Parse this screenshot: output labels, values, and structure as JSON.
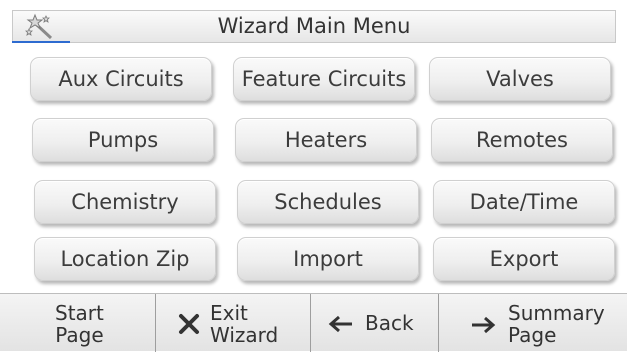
{
  "header": {
    "title": "Wizard Main Menu",
    "icon": "magic-wand-icon"
  },
  "menu": {
    "buttons": [
      {
        "label": "Aux Circuits"
      },
      {
        "label": "Feature Circuits"
      },
      {
        "label": "Valves"
      },
      {
        "label": "Pumps"
      },
      {
        "label": "Heaters"
      },
      {
        "label": "Remotes"
      },
      {
        "label": "Chemistry"
      },
      {
        "label": "Schedules"
      },
      {
        "label": "Date/Time"
      },
      {
        "label": "Location Zip"
      },
      {
        "label": "Import"
      },
      {
        "label": "Export"
      }
    ]
  },
  "footer": {
    "start_line1": "Start",
    "start_line2": "Page",
    "exit_line1": "Exit",
    "exit_line2": "Wizard",
    "exit_icon": "close-x-icon",
    "back_label": "Back",
    "back_icon": "arrow-left-icon",
    "summary_line1": "Summary",
    "summary_line2": "Page",
    "summary_icon": "arrow-right-icon"
  },
  "colors": {
    "accent": "#2d6bd0",
    "wand_icon": "#8a8a8a"
  }
}
